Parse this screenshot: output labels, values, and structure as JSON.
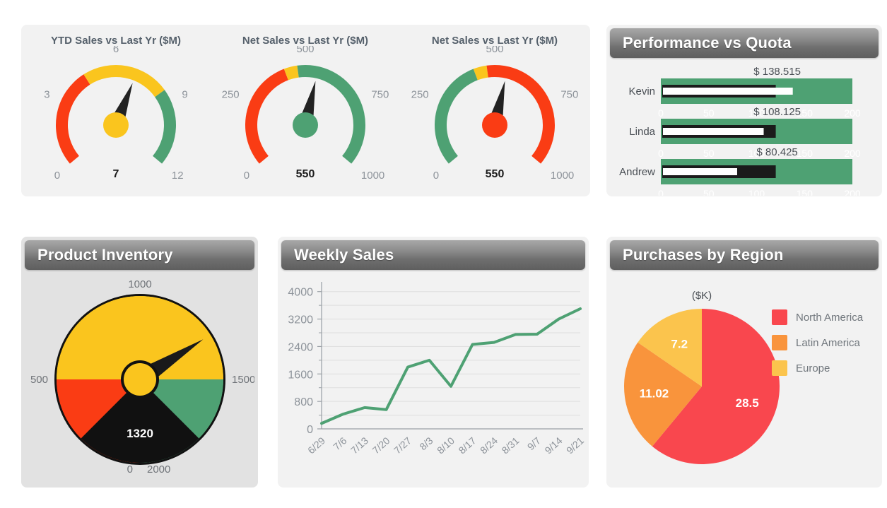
{
  "theme": {
    "page_bg": "#ffffff",
    "panel_bg": "#f2f2f2",
    "panel_bg_alt": "#e2e2e2",
    "header_grad_top": "#a8a8a8",
    "header_grad_bottom": "#5f5f5f",
    "header_text": "#ffffff",
    "axis_text": "#8d939a",
    "title_text": "#55606b",
    "red": "#fa3c14",
    "orange": "#f97d3c",
    "yellow": "#fac51e",
    "green": "#4ea173",
    "pie_red": "#f9474e",
    "pie_orange": "#f9943c",
    "pie_yellow": "#fbc44d",
    "line_green": "#4ea173",
    "black": "#1e1e1e",
    "white": "#ffffff"
  },
  "gauges": [
    {
      "id": "ytd-sales",
      "title": "YTD Sales vs Last Yr ($M)",
      "value": 7,
      "value_label": "7",
      "min": 0,
      "max": 12,
      "tick_labels": [
        "0",
        "3",
        "6",
        "9",
        "12"
      ],
      "tick_values": [
        0,
        3,
        6,
        9,
        12
      ],
      "hub_color": "#fac51e",
      "bands": [
        {
          "from": 0,
          "to": 4.5,
          "color": "#fa3c14"
        },
        {
          "from": 4.5,
          "to": 8.5,
          "color": "#fac51e"
        },
        {
          "from": 8.5,
          "to": 12,
          "color": "#4ea173"
        }
      ]
    },
    {
      "id": "net-sales-green",
      "title": "Net Sales vs Last Yr ($M)",
      "value": 550,
      "value_label": "550",
      "min": 0,
      "max": 1000,
      "tick_labels": [
        "0",
        "250",
        "500",
        "750",
        "1000"
      ],
      "tick_values": [
        0,
        250,
        500,
        750,
        1000
      ],
      "hub_color": "#4ea173",
      "bands": [
        {
          "from": 0,
          "to": 420,
          "color": "#fa3c14"
        },
        {
          "from": 420,
          "to": 470,
          "color": "#fac51e"
        },
        {
          "from": 470,
          "to": 1000,
          "color": "#4ea173"
        }
      ]
    },
    {
      "id": "net-sales-red",
      "title": "Net Sales vs Last Yr ($M)",
      "value": 550,
      "value_label": "550",
      "min": 0,
      "max": 1000,
      "tick_labels": [
        "0",
        "250",
        "500",
        "750",
        "1000"
      ],
      "tick_values": [
        0,
        250,
        500,
        750,
        1000
      ],
      "hub_color": "#fa3c14",
      "bands": [
        {
          "from": 0,
          "to": 420,
          "color": "#4ea173"
        },
        {
          "from": 420,
          "to": 470,
          "color": "#fac51e"
        },
        {
          "from": 470,
          "to": 1000,
          "color": "#fa3c14"
        }
      ]
    }
  ],
  "quota_panel": {
    "title": "Performance vs Quota",
    "axis_labels": [
      "0",
      "50",
      "100",
      "150",
      "200"
    ],
    "axis_values": [
      0,
      50,
      100,
      150,
      200
    ],
    "range_max": 200,
    "rows": [
      {
        "name": "Kevin",
        "value_label": "$ 138.515",
        "value": 138.515,
        "target": 120,
        "bar_color": "#4ea173"
      },
      {
        "name": "Linda",
        "value_label": "$ 108.125",
        "value": 108.125,
        "target": 120,
        "bar_color": "#4ea173"
      },
      {
        "name": "Andrew",
        "value_label": "$ 80.425",
        "value": 80.425,
        "target": 120,
        "bar_color": "#4ea173"
      }
    ]
  },
  "inventory_panel": {
    "title": "Product Inventory",
    "value": 1320,
    "value_label": "1320",
    "min": 0,
    "max": 2000,
    "tick_labels": [
      "0",
      "500",
      "1000",
      "1500",
      "2000"
    ],
    "tick_values": [
      0,
      500,
      1000,
      1500,
      2000
    ],
    "hub_color": "#fac51e",
    "bands": [
      {
        "from": 0,
        "to": 500,
        "color": "#fa3c14"
      },
      {
        "from": 500,
        "to": 1000,
        "color": "#fac51e"
      },
      {
        "from": 1000,
        "to": 1500,
        "color": "#fac51e"
      },
      {
        "from": 1500,
        "to": 2000,
        "color": "#4ea173"
      }
    ]
  },
  "weekly_panel": {
    "title": "Weekly Sales"
  },
  "region_panel": {
    "title": "Purchases by Region",
    "unit_label": "($K)"
  },
  "chart_data": [
    {
      "type": "line",
      "id": "weekly-sales",
      "title": "Weekly Sales",
      "xlabel": "",
      "ylabel": "",
      "ylim": [
        0,
        4200
      ],
      "yticks": [
        0,
        800,
        1600,
        2400,
        3200,
        4000
      ],
      "ytick_labels": [
        "0",
        "800",
        "1600",
        "2400",
        "3200",
        "4000"
      ],
      "minor_ytick_step": 400,
      "grid": true,
      "legend": "none",
      "line_color": "#4ea173",
      "categories": [
        "6/29",
        "7/6",
        "7/13",
        "7/20",
        "7/27",
        "8/3",
        "8/10",
        "8/17",
        "8/24",
        "8/31",
        "9/7",
        "9/14",
        "9/21"
      ],
      "values": [
        160,
        430,
        620,
        560,
        1800,
        2000,
        1240,
        2460,
        2520,
        2750,
        2760,
        3200,
        3500
      ]
    },
    {
      "type": "pie",
      "id": "purchases-by-region",
      "title": "Purchases by Region",
      "unit_label": "($K)",
      "legend": "right",
      "labels": [
        "North America",
        "Latin America",
        "Europe"
      ],
      "values": [
        28.5,
        11.02,
        7.2
      ],
      "value_labels": [
        "28.5",
        "11.02",
        "7.2"
      ],
      "colors": [
        "#f9474e",
        "#f9943c",
        "#fbc44d"
      ]
    },
    {
      "type": "bar",
      "id": "performance-vs-quota",
      "title": "Performance vs Quota",
      "categories": [
        "Kevin",
        "Linda",
        "Andrew"
      ],
      "values": [
        138.515,
        108.125,
        80.425
      ],
      "targets": [
        120,
        120,
        120
      ],
      "xlim": [
        0,
        200
      ],
      "xticks": [
        0,
        50,
        100,
        150,
        200
      ],
      "ylabel": "",
      "xlabel": ""
    },
    {
      "type": "gauge",
      "id": "product-inventory",
      "title": "Product Inventory",
      "value": 1320,
      "min": 0,
      "max": 2000,
      "ticks": [
        0,
        500,
        1000,
        1500,
        2000
      ]
    }
  ]
}
